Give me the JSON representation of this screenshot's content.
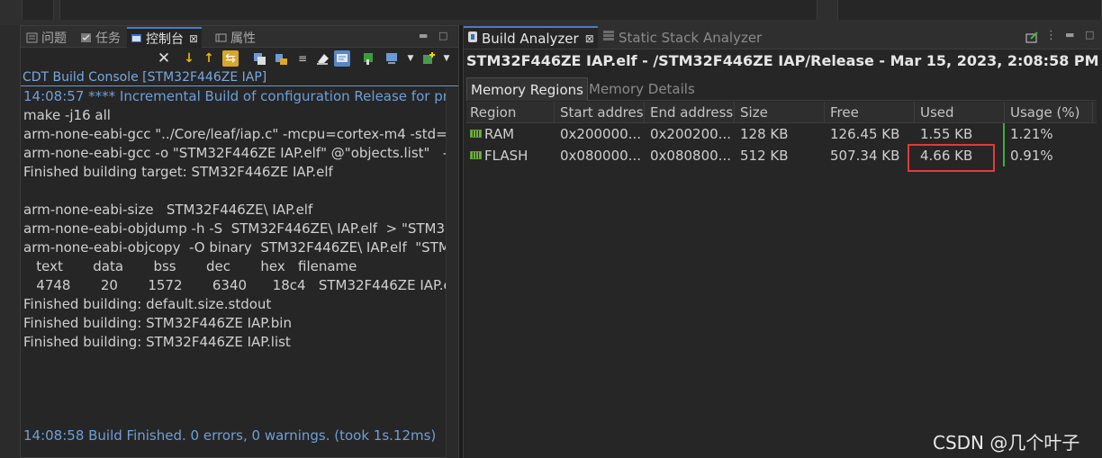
{
  "left_panel": {
    "tabs": [
      {
        "label": "问题",
        "icon": "problems-icon"
      },
      {
        "label": "任务",
        "icon": "tasks-icon"
      },
      {
        "label": "控制台",
        "icon": "console-icon",
        "active": true
      },
      {
        "label": "属性",
        "icon": "properties-icon"
      }
    ],
    "close_glyph": "✕",
    "console_title": "CDT Build Console [STM32F446ZE IAP]",
    "console_lines": [
      "14:08:57 **** Incremental Build of configuration Release for proj",
      "make -j16 all",
      "arm-none-eabi-gcc \"../Core/leaf/iap.c\" -mcpu=cortex-m4 -std=",
      "arm-none-eabi-gcc -o \"STM32F446ZE IAP.elf\" @\"objects.list\"   -",
      "Finished building target: STM32F446ZE IAP.elf",
      "",
      "arm-none-eabi-size   STM32F446ZE\\ IAP.elf",
      "arm-none-eabi-objdump -h -S  STM32F446ZE\\ IAP.elf  > \"STM3",
      "arm-none-eabi-objcopy  -O binary  STM32F446ZE\\ IAP.elf  \"STM",
      "   text       data       bss       dec       hex   filename",
      "   4748       20       1572       6340      18c4   STM32F446ZE IAP.elf",
      "Finished building: default.size.stdout",
      "Finished building: STM32F446ZE IAP.bin",
      "Finished building: STM32F446ZE IAP.list"
    ],
    "finish_line": "14:08:58 Build Finished. 0 errors, 0 warnings. (took 1s.12ms)"
  },
  "right_panel": {
    "tabs": [
      {
        "label": "Build Analyzer",
        "active": true
      },
      {
        "label": "Static Stack Analyzer",
        "active": false
      }
    ],
    "headline": "STM32F446ZE IAP.elf - /STM32F446ZE IAP/Release - Mar 15, 2023, 2:08:58 PM",
    "subtabs": [
      {
        "label": "Memory Regions",
        "active": true
      },
      {
        "label": "Memory Details",
        "active": false
      }
    ],
    "columns": [
      "Region",
      "Start addres",
      "End address",
      "Size",
      "Free",
      "Used",
      "Usage (%)"
    ],
    "rows": [
      {
        "region": "RAM",
        "start": "0x200000...",
        "end": "0x200200...",
        "size": "128 KB",
        "free": "126.45 KB",
        "used": "1.55 KB",
        "usage": "1.21%"
      },
      {
        "region": "FLASH",
        "start": "0x080000...",
        "end": "0x080800...",
        "size": "512 KB",
        "free": "507.34 KB",
        "used": "4.66 KB",
        "usage": "0.91%"
      }
    ],
    "highlighted_cell": "FLASH used",
    "highlight_color": "#e23a3a"
  },
  "watermark": "CSDN @几个叶子"
}
